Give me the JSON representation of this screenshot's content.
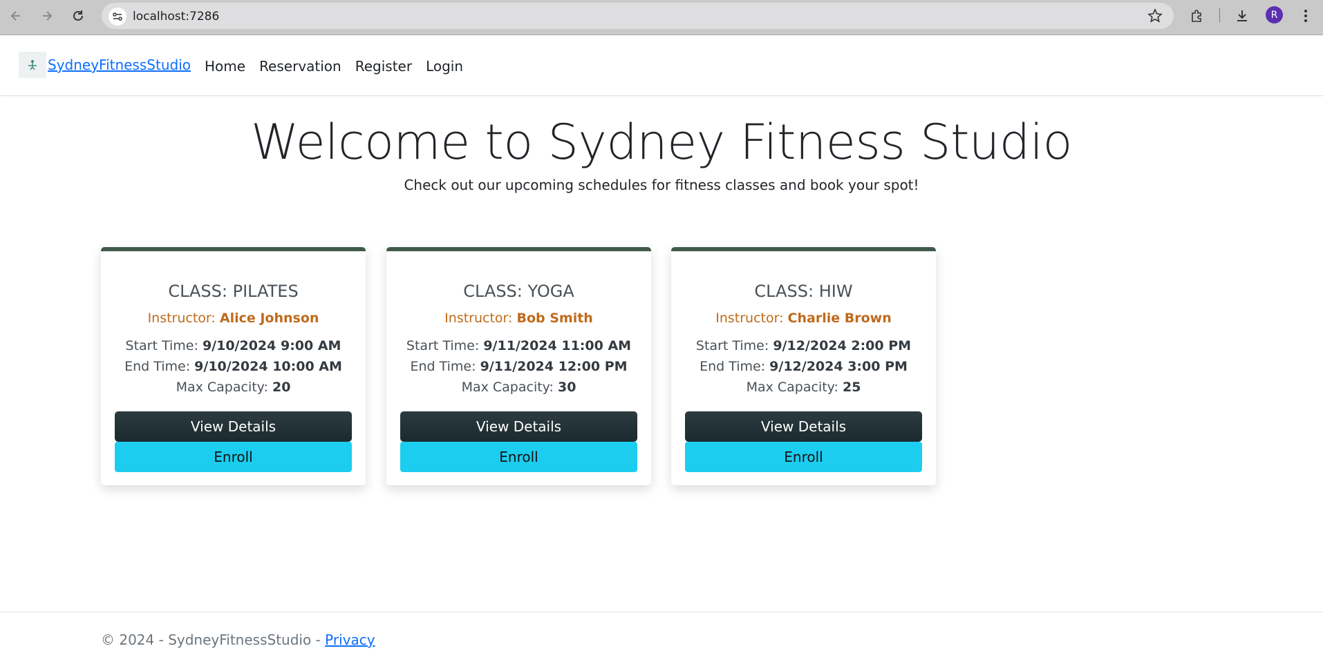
{
  "browser": {
    "url": "localhost:7286",
    "profile_initial": "R",
    "icons": [
      "back-arrow-icon",
      "forward-arrow-icon",
      "reload-icon",
      "site-settings-icon",
      "bookmark-star-icon",
      "extensions-icon",
      "download-icon",
      "more-vert-icon"
    ]
  },
  "navbar": {
    "brand": "SydneyFitnessStudio",
    "links": [
      "Home",
      "Reservation",
      "Register",
      "Login"
    ]
  },
  "hero": {
    "title": "Welcome to Sydney Fitness Studio",
    "subtitle": "Check out our upcoming schedules for fitness classes and book your spot!"
  },
  "labels": {
    "instructor": "Instructor:",
    "start": "Start Time:",
    "end": "End Time:",
    "capacity": "Max Capacity:",
    "view_details": "View Details",
    "enroll": "Enroll"
  },
  "classes": [
    {
      "title": "CLASS: PILATES",
      "instructor": "Alice Johnson",
      "start": "9/10/2024 9:00 AM",
      "end": "9/10/2024 10:00 AM",
      "capacity": "20"
    },
    {
      "title": "CLASS: YOGA",
      "instructor": "Bob Smith",
      "start": "9/11/2024 11:00 AM",
      "end": "9/11/2024 12:00 PM",
      "capacity": "30"
    },
    {
      "title": "CLASS: HIW",
      "instructor": "Charlie Brown",
      "start": "9/12/2024 2:00 PM",
      "end": "9/12/2024 3:00 PM",
      "capacity": "25"
    }
  ],
  "footer": {
    "copyright": "© 2024 - SydneyFitnessStudio - ",
    "privacy": "Privacy"
  },
  "colors": {
    "card_accent": "#3f5a4b",
    "instructor": "#c06a1a",
    "details_button": "#1f2e33",
    "enroll_button": "#1ccdef",
    "link": "#0d6efd"
  }
}
